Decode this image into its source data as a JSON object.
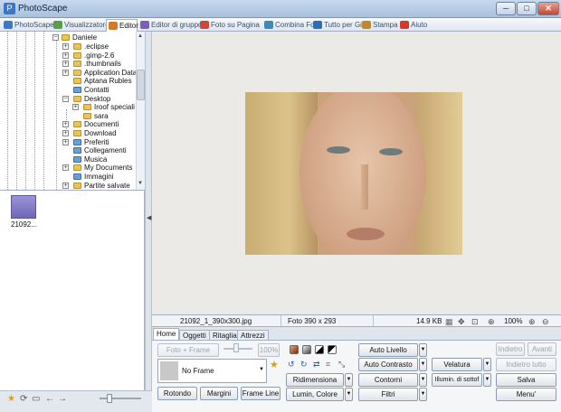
{
  "window": {
    "title": "PhotoScape",
    "app_icon": "photoscape-icon",
    "min": "─",
    "max": "□",
    "close": "✕"
  },
  "tabs": [
    {
      "label": "PhotoScape",
      "icon": "photoscape-tab-icon",
      "color": "#3b78c8"
    },
    {
      "label": "Visualizzatore",
      "icon": "viewer-icon",
      "color": "#5aa04a"
    },
    {
      "label": "Editor",
      "icon": "editor-icon",
      "color": "#d27b2a"
    },
    {
      "label": "Editor di gruppo",
      "icon": "batch-editor-icon",
      "color": "#7a5fb4"
    },
    {
      "label": "Foto su Pagina",
      "icon": "page-icon",
      "color": "#c9483b"
    },
    {
      "label": "Combina Foto",
      "icon": "combine-icon",
      "color": "#3d8bb3"
    },
    {
      "label": "Tutto per Gif",
      "icon": "gif-icon",
      "color": "#2f6fb0"
    },
    {
      "label": "Stampa",
      "icon": "print-icon",
      "color": "#c08a2c"
    },
    {
      "label": "Aiuto",
      "icon": "help-icon",
      "color": "#d23a2a"
    }
  ],
  "tree": {
    "root": "Daniele",
    "items": [
      ".eclipse",
      ".gimp-2.6",
      ".thumbnails",
      "Application Data",
      "Aptana Rubles",
      "Contatti",
      "Desktop",
      "Iroof speciali",
      "sara",
      "Documenti",
      "Download",
      "Preferiti",
      "Collegamenti",
      "Musica",
      "My Documents",
      "Immagini",
      "Partite salvate"
    ]
  },
  "thumbnail": {
    "label": "21092..."
  },
  "status": {
    "filename": "21092_1_390x300.jpg",
    "photo_size": "Foto 390 x 293",
    "file_size": "14.9 KB",
    "zoom": "100%"
  },
  "edit_tabs": [
    "Home",
    "Oggetti",
    "Ritaglia",
    "Attrezzi"
  ],
  "home": {
    "foto_frame": "Foto + Frame",
    "slider_value": "100%",
    "frame_select": "No Frame",
    "rotondo": "Rotondo",
    "margini": "Margini",
    "frame_line": "Frame Line",
    "ridimensiona": "Ridimensiona",
    "lumin_colore": "Lumin, Colore",
    "auto_livello": "Auto Livello",
    "auto_contrasto": "Auto Contrasto",
    "contorni": "Contorni",
    "filtri": "Filtri",
    "velatura": "Velatura",
    "illumin": "Illumin. di sottof",
    "indietro": "Indietro",
    "avanti": "Avanti",
    "indietro_tutto": "Indietro tutto",
    "salva": "Salva",
    "menu": "Menu'"
  }
}
